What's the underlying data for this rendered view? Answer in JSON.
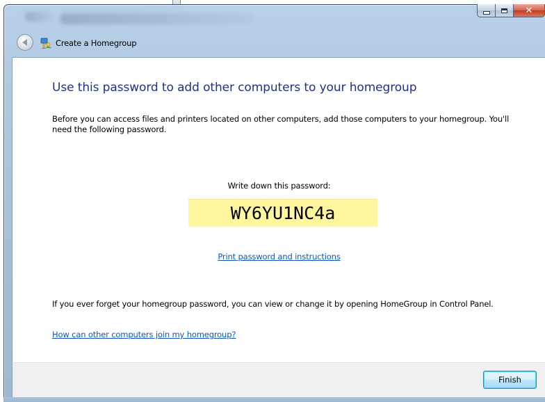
{
  "window": {
    "title": "Create a Homegroup",
    "caption_buttons": {
      "minimize": "minimize",
      "maximize": "maximize",
      "close": "close"
    }
  },
  "content": {
    "heading": "Use this password to add other computers to your homegroup",
    "intro": "Before you can access files and printers located on other computers, add those computers to your homegroup. You'll need the following password.",
    "password_label": "Write down this password:",
    "password": "WY6YU1NC4a",
    "print_link": "Print password and instructions",
    "forget_text": "If you ever forget your homegroup password, you can view or change it by opening HomeGroup in Control Panel.",
    "help_link": "How can other computers join my homegroup?"
  },
  "footer": {
    "finish_label": "Finish"
  },
  "colors": {
    "heading": "#1e3287",
    "link": "#0d56b8",
    "password_highlight": "#fff69e",
    "close_button": "#c23b1e"
  }
}
